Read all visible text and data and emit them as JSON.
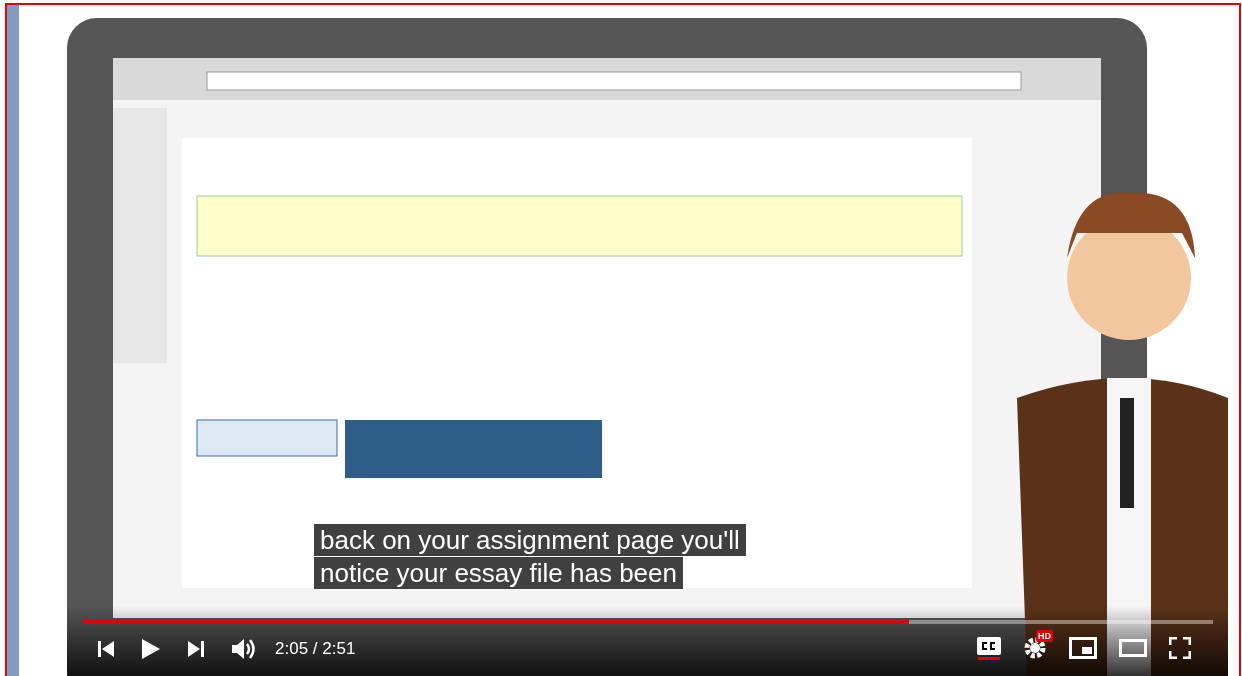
{
  "captions": [
    "back on your assignment page you'll",
    "notice your essay file has been"
  ],
  "player": {
    "progress": {
      "level": 0.731
    },
    "time": "2:05 / 2:51",
    "captions_on": true,
    "quality_badge": "HD"
  }
}
